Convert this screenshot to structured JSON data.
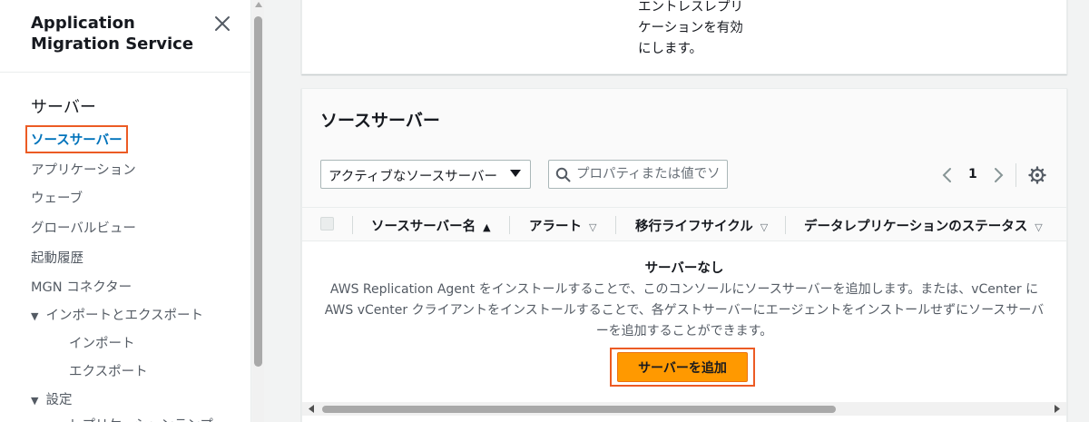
{
  "sidebar": {
    "app_title": "Application Migration Service",
    "nav_heading": "サーバー",
    "items": [
      {
        "label": "ソースサーバー",
        "active": true
      },
      {
        "label": "アプリケーション"
      },
      {
        "label": "ウェーブ"
      },
      {
        "label": "グローバルビュー"
      },
      {
        "label": "起動履歴"
      },
      {
        "label": "MGN コネクター"
      }
    ],
    "group_import_export": {
      "label": "インポートとエクスポート",
      "children": [
        "インポート",
        "エクスポート"
      ]
    },
    "group_settings": {
      "label": "設定",
      "children": [
        "レプリケーションテンプ"
      ]
    }
  },
  "top_card": {
    "text": "エントレスレプリケーションを有効にします。"
  },
  "source_servers": {
    "title": "ソースサーバー",
    "filter": {
      "selected": "アクティブなソースサーバー"
    },
    "search": {
      "placeholder": "プロパティまたは値でソ"
    },
    "pagination": {
      "current_page": "1"
    },
    "columns": [
      {
        "label": "ソースサーバー名",
        "sort": "ascending"
      },
      {
        "label": "アラート",
        "sort": "none"
      },
      {
        "label": "移行ライフサイクル",
        "sort": "none"
      },
      {
        "label": "データレプリケーションのステータス",
        "sort": "none"
      }
    ],
    "empty": {
      "title": "サーバーなし",
      "description": "AWS Replication Agent をインストールすることで、このコンソールにソースサーバーを追加します。または、vCenter に AWS vCenter クライアントをインストールすることで、各ゲストサーバーにエージェントをインストールせずにソースサーバーを追加することができます。",
      "add_button": "サーバーを追加"
    }
  },
  "colors": {
    "accent_orange": "#ff9900",
    "highlight_outline": "#ec5b24",
    "link_blue": "#0073bb"
  }
}
